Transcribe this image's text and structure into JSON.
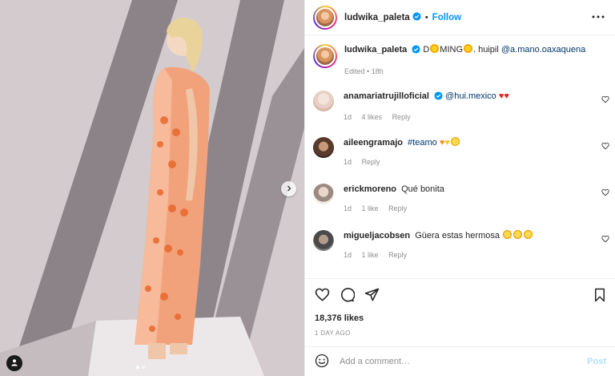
{
  "post": {
    "username": "ludwika_paleta",
    "follow_label": "Follow",
    "separator": "•",
    "caption_pre": "D",
    "caption_mid": "MING",
    "caption_post": ". huipil",
    "caption_mention": "@a.mano.oaxaquena",
    "edited_label": "Edited",
    "time_ago": "18h"
  },
  "comments": [
    {
      "username": "anamariatrujilloficial",
      "text": "@hui.mexico",
      "likes": "4 likes",
      "time": "1d",
      "reply": "Reply",
      "emojis": [
        "red-heart",
        "red-heart"
      ]
    },
    {
      "username": "aileengramajo",
      "text": "#teamo",
      "likes": "",
      "time": "1d",
      "reply": "Reply",
      "emojis": [
        "orange-heart",
        "yellow-heart",
        "smiling-tear-face"
      ]
    },
    {
      "username": "erickmoreno",
      "text": "Qué bonita",
      "likes": "1 like",
      "time": "1d",
      "reply": "Reply",
      "emojis": []
    },
    {
      "username": "migueljacobsen",
      "text": "Güera estas hermosa",
      "likes": "1 like",
      "time": "1d",
      "reply": "Reply",
      "emojis": [
        "heart-eyes-face",
        "heart-eyes-face",
        "heart-eyes-face"
      ]
    }
  ],
  "stats": {
    "likes": "18,376 likes",
    "date": "1 DAY AGO"
  },
  "composer": {
    "placeholder": "Add a comment…",
    "post_label": "Post"
  },
  "icons": {
    "like": "heart-outline-icon",
    "comment": "comment-bubble-icon",
    "share": "paper-plane-icon",
    "save": "bookmark-icon",
    "more": "more-horizontal-icon",
    "emoji": "smiley-icon",
    "next": "chevron-right-icon",
    "tag": "person-tag-icon"
  },
  "colors": {
    "accent": "#0095f6",
    "verified": "#0095f6",
    "muted": "#8e8e8e",
    "post_disabled": "#b2dffc",
    "mention": "#00376b"
  }
}
